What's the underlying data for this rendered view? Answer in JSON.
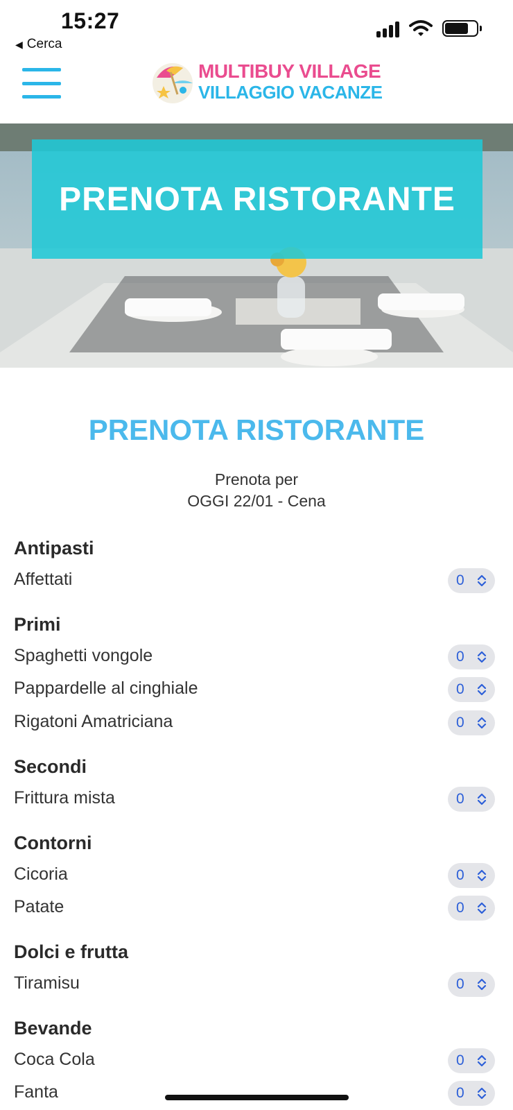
{
  "status_bar": {
    "time": "15:27",
    "back_label": "Cerca"
  },
  "header": {
    "logo_line1": "MULTIBUY VILLAGE",
    "logo_line2": "VILLAGGIO VACANZE"
  },
  "hero": {
    "banner_title": "PRENOTA RISTORANTE"
  },
  "page": {
    "title": "PRENOTA RISTORANTE",
    "subtitle_line1": "Prenota per",
    "subtitle_line2": "OGGI 22/01 - Cena"
  },
  "menu": [
    {
      "heading": "Antipasti",
      "items": [
        {
          "name": "Affettati",
          "qty": "0"
        }
      ]
    },
    {
      "heading": "Primi",
      "items": [
        {
          "name": "Spaghetti vongole",
          "qty": "0"
        },
        {
          "name": "Pappardelle al cinghiale",
          "qty": "0"
        },
        {
          "name": "Rigatoni Amatriciana",
          "qty": "0"
        }
      ]
    },
    {
      "heading": "Secondi",
      "items": [
        {
          "name": "Frittura mista",
          "qty": "0"
        }
      ]
    },
    {
      "heading": "Contorni",
      "items": [
        {
          "name": "Cicoria",
          "qty": "0"
        },
        {
          "name": "Patate",
          "qty": "0"
        }
      ]
    },
    {
      "heading": "Dolci e frutta",
      "items": [
        {
          "name": "Tiramisu",
          "qty": "0"
        }
      ]
    },
    {
      "heading": "Bevande",
      "items": [
        {
          "name": "Coca Cola",
          "qty": "0"
        },
        {
          "name": "Fanta",
          "qty": "0"
        }
      ]
    }
  ],
  "colors": {
    "accent": "#2bb6e8",
    "title_blue": "#4bb9ec",
    "banner_teal": "#20c8d6",
    "logo_pink": "#ea4c8f",
    "select_value": "#2c5fd8"
  },
  "icons": {
    "back": "back-triangle-icon",
    "signal": "cellular-signal-icon",
    "wifi": "wifi-icon",
    "battery": "battery-icon",
    "menu": "hamburger-menu-icon",
    "select": "chevron-up-down-icon"
  }
}
